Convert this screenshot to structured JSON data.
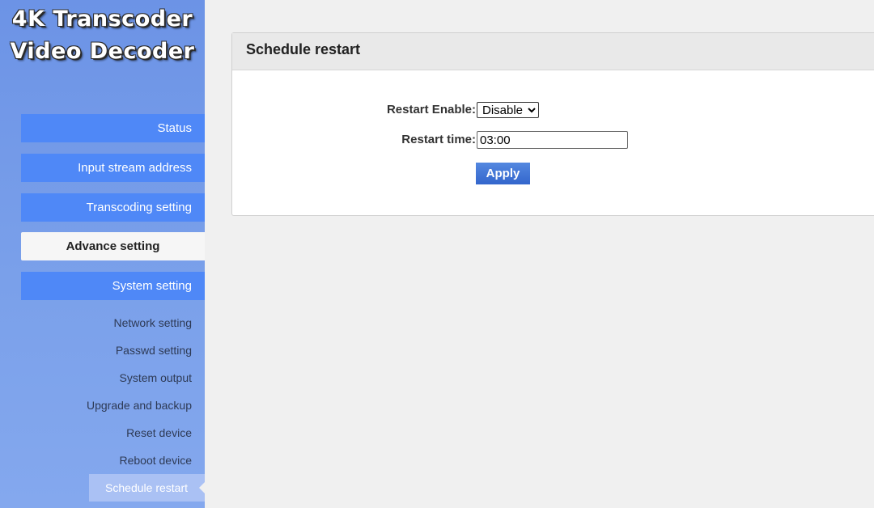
{
  "logo": {
    "line1": "4K Transcoder",
    "line2": "Video Decoder"
  },
  "nav": {
    "status": "Status",
    "input_stream": "Input stream address",
    "transcoding": "Transcoding setting",
    "advance": "Advance setting",
    "system": "System setting"
  },
  "submenu": {
    "network": "Network setting",
    "passwd": "Passwd setting",
    "system_output": "System output",
    "upgrade": "Upgrade and backup",
    "reset": "Reset device",
    "reboot": "Reboot device",
    "schedule": "Schedule restart"
  },
  "panel": {
    "title": "Schedule restart",
    "restart_enable_label": "Restart Enable:",
    "restart_enable_value": "Disable",
    "restart_time_label": "Restart time:",
    "restart_time_value": "03:00",
    "apply_label": "Apply"
  },
  "colors": {
    "nav_button": "#4f88f7",
    "sidebar": "#7aa0ea",
    "apply_button": "#3366cc"
  }
}
